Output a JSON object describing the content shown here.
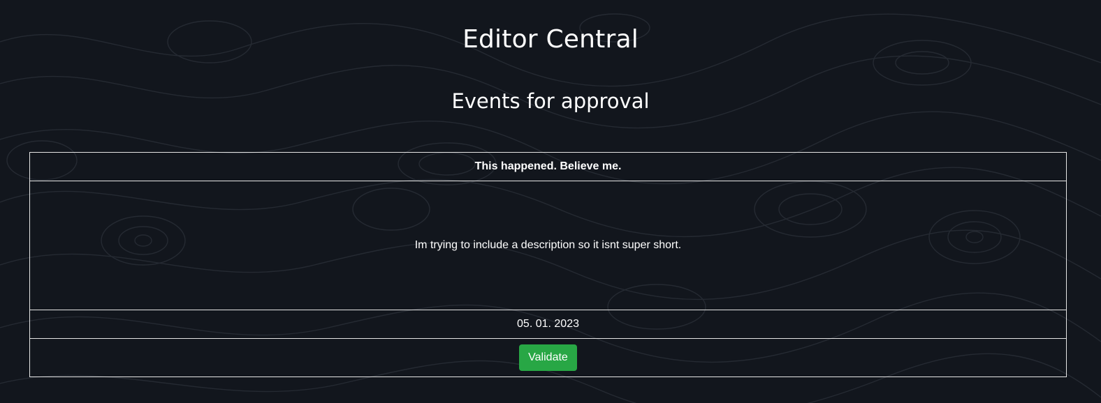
{
  "header": {
    "title": "Editor Central",
    "subtitle": "Events for approval"
  },
  "events": [
    {
      "title": "This happened. Believe me.",
      "description": "Im trying to include a description so it isnt super short.",
      "date": "05. 01. 2023",
      "action_label": "Validate"
    }
  ],
  "colors": {
    "background": "#12161d",
    "border": "#e6e6e6",
    "validate_button": "#28a745"
  }
}
